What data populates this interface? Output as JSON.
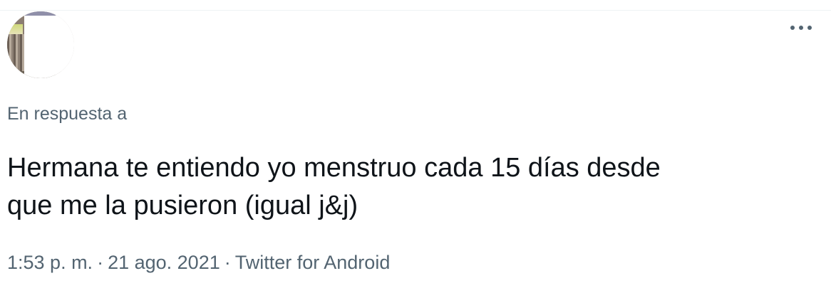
{
  "tweet": {
    "more_icon": "more-horizontal-icon",
    "reply_label": "En respuesta a",
    "text_line1": "Hermana te entiendo yo menstruo cada 15 días desde",
    "text_line2": "que me la pusieron (igual j&j)",
    "time": "1:53 p. m.",
    "separator": "·",
    "date": "21 ago. 2021",
    "source": "Twitter for Android"
  },
  "colors": {
    "primary_text": "#0f1419",
    "secondary_text": "#536471",
    "divider": "#eff3f4"
  }
}
